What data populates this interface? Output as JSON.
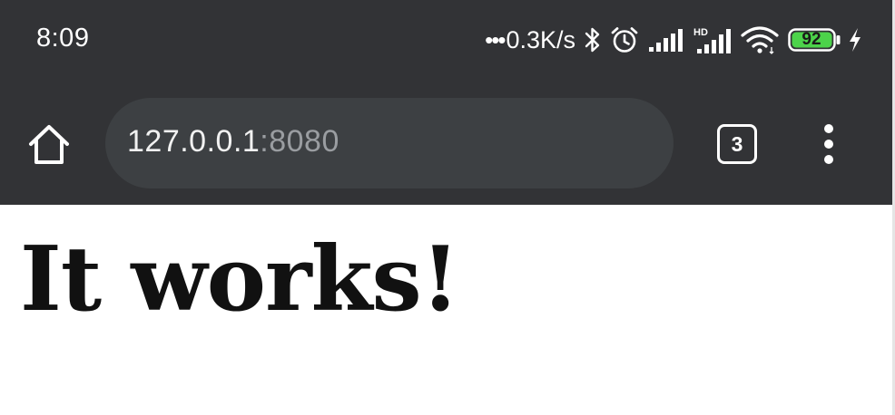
{
  "status_bar": {
    "time": "8:09",
    "net_dots": "•••",
    "net_speed": "0.3K/s",
    "battery_level": "92",
    "icons": [
      "bluetooth-icon",
      "alarm-icon",
      "signal-icon",
      "hd-signal-icon",
      "wifi-icon",
      "battery-icon",
      "charging-icon"
    ],
    "battery_color": "#4cd34a"
  },
  "toolbar": {
    "home_icon": "home-icon",
    "url_host": "127.0.0.1",
    "url_port": ":8080",
    "tab_count": "3",
    "menu_icon": "more-vert-icon"
  },
  "page": {
    "heading": "It works!"
  },
  "colors": {
    "chrome_bg": "#323336",
    "url_bar_bg": "#3d4043",
    "page_bg": "#ffffff"
  }
}
